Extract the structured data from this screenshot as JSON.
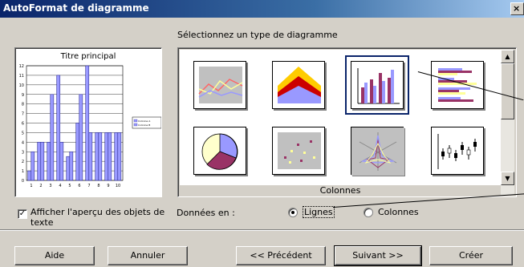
{
  "dialog": {
    "title": "AutoFormat de diagramme",
    "close_glyph": "×"
  },
  "select_label": "Sélectionnez un type de diagramme",
  "preview": {
    "title": "Titre principal",
    "y_ticks": [
      "0",
      "1",
      "2",
      "3",
      "4",
      "5",
      "6",
      "7",
      "8",
      "9",
      "10",
      "11",
      "12"
    ],
    "x_ticks": [
      "1",
      "2",
      "3",
      "4",
      "5",
      "6",
      "7",
      "8",
      "9",
      "10"
    ],
    "legend": [
      "Colonne A",
      "Colonne B"
    ],
    "chart_data": {
      "type": "bar",
      "title": "Titre principal",
      "categories": [
        "1",
        "2",
        "3",
        "4",
        "5",
        "6",
        "7",
        "8",
        "9",
        "10"
      ],
      "series": [
        {
          "values": [
            1,
            4,
            4,
            11,
            2.5,
            6,
            12,
            5,
            5,
            5
          ]
        },
        {
          "values": [
            3,
            4,
            9,
            4,
            3,
            9,
            5,
            5,
            5,
            5
          ]
        }
      ],
      "ylim": [
        0,
        12
      ]
    }
  },
  "gallery": {
    "caption": "Colonnes",
    "types": [
      "Lignes",
      "Aires",
      "Colonnes",
      "Barres",
      "Secteurs",
      "XY (dispersion)",
      "Toile",
      "Cours"
    ],
    "selected": "Colonnes"
  },
  "show_text_checkbox": {
    "label": "Afficher l'aperçu des objets de texte",
    "checked": true
  },
  "data_in": {
    "label": "Données en :",
    "options": [
      {
        "label": "Lignes",
        "selected": true
      },
      {
        "label": "Colonnes",
        "selected": false
      }
    ]
  },
  "buttons": {
    "help": "Aide",
    "cancel": "Annuler",
    "previous": "<< Précédent",
    "next": "Suivant >>",
    "create": "Créer"
  },
  "colors": {
    "bar_fill": "#9999ff",
    "bar_stroke": "#333399",
    "selection": "#0a246a",
    "title_start": "#0a246a",
    "title_end": "#a6caf0"
  }
}
